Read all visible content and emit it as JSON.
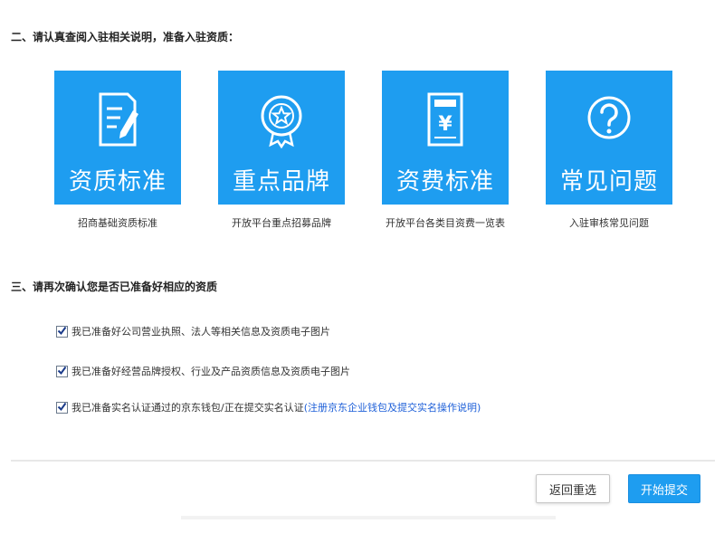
{
  "section2": {
    "title": "二、请认真查阅入驻相关说明，准备入驻资质："
  },
  "cards": [
    {
      "label": "资质标准",
      "caption": "招商基础资质标准",
      "icon": "document-edit-icon"
    },
    {
      "label": "重点品牌",
      "caption": "开放平台重点招募品牌",
      "icon": "brand-star-badge-icon"
    },
    {
      "label": "资费标准",
      "caption": "开放平台各类目资费一览表",
      "icon": "yuan-bill-icon"
    },
    {
      "label": "常见问题",
      "caption": "入驻审核常见问题",
      "icon": "question-circle-icon"
    }
  ],
  "section3": {
    "title": "三、请再次确认您是否已准备好相应的资质"
  },
  "checks": [
    {
      "text": "我已准备好公司营业执照、法人等相关信息及资质电子图片",
      "checked": true
    },
    {
      "text": "我已准备好经营品牌授权、行业及产品资质信息及资质电子图片",
      "checked": true
    },
    {
      "text": "我已准备实名认证通过的京东钱包/正在提交实名认证",
      "link": "(注册京东企业钱包及提交实名操作说明)",
      "checked": true
    }
  ],
  "buttons": {
    "back": "返回重选",
    "submit": "开始提交"
  },
  "colors": {
    "card_bg": "#1e9df0",
    "link": "#1d5fd8",
    "primary": "#1e9df0"
  }
}
